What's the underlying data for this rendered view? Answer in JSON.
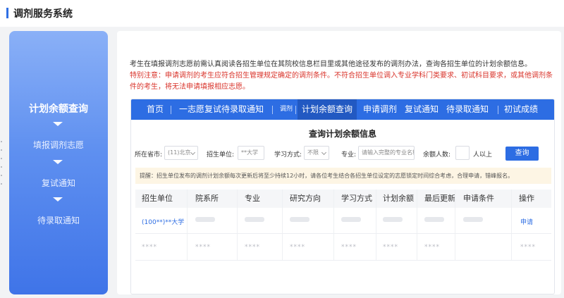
{
  "header": {
    "title": "调剂服务系统"
  },
  "sidebar": {
    "items": [
      {
        "label": "计划余额查询",
        "active": true
      },
      {
        "label": "填报调剂志愿",
        "active": false
      },
      {
        "label": "复试通知",
        "active": false
      },
      {
        "label": "待录取通知",
        "active": false
      }
    ]
  },
  "intro": {
    "text": "考生在填报调剂志愿前需认真阅读各招生单位在其院校信息栏目里或其他途径发布的调剂办法，查询各招生单位的计划余额信息。",
    "warning": "特别注意：申请调剂的考生应符合招生管理规定确定的调剂条件。不符合招生单位调入专业学科门类要求、初试科目要求，或其他调剂条件的考生，将无法申请填报相应志愿。"
  },
  "nav": {
    "items": [
      {
        "label": "首页"
      },
      {
        "label": "一志愿复试待录取通知"
      },
      {
        "label": "调剂"
      },
      {
        "label": "计划余额查询",
        "active": true
      },
      {
        "label": "申请调剂"
      },
      {
        "label": "复试通知"
      },
      {
        "label": "待录取通知"
      },
      {
        "label": "初试成绩"
      }
    ]
  },
  "query": {
    "title": "查询计划余额信息",
    "province_label": "所在省市:",
    "province_value": "(11)北京",
    "unit_label": "招生单位:",
    "unit_value": "**大学",
    "mode_label": "学习方式:",
    "mode_value": "不限",
    "major_label": "专业:",
    "major_placeholder": "请输入完整的专业名称",
    "remaining_label": "余额人数:",
    "remaining_value": "",
    "remaining_suffix": "人以上",
    "search_button": "查询"
  },
  "notice": "提醒：招生单位发布的调剂计划余额每次更新后将至少持续12小时，请各位考生结合各招生单位设定的志愿锁定时间综合考虑，合理申请，错峰报名。",
  "table": {
    "headers": [
      "招生单位",
      "院系所",
      "专业",
      "研究方向",
      "学习方式",
      "计划余额",
      "最后更新",
      "申请条件",
      "操作"
    ],
    "row1": {
      "unit": "(100**)**大学",
      "action": "申请"
    },
    "row2": {
      "mask": "****"
    }
  },
  "colors": {
    "brand": "#2d6de3",
    "warning": "#d9342b",
    "notice_bg": "#fdf5e4"
  }
}
